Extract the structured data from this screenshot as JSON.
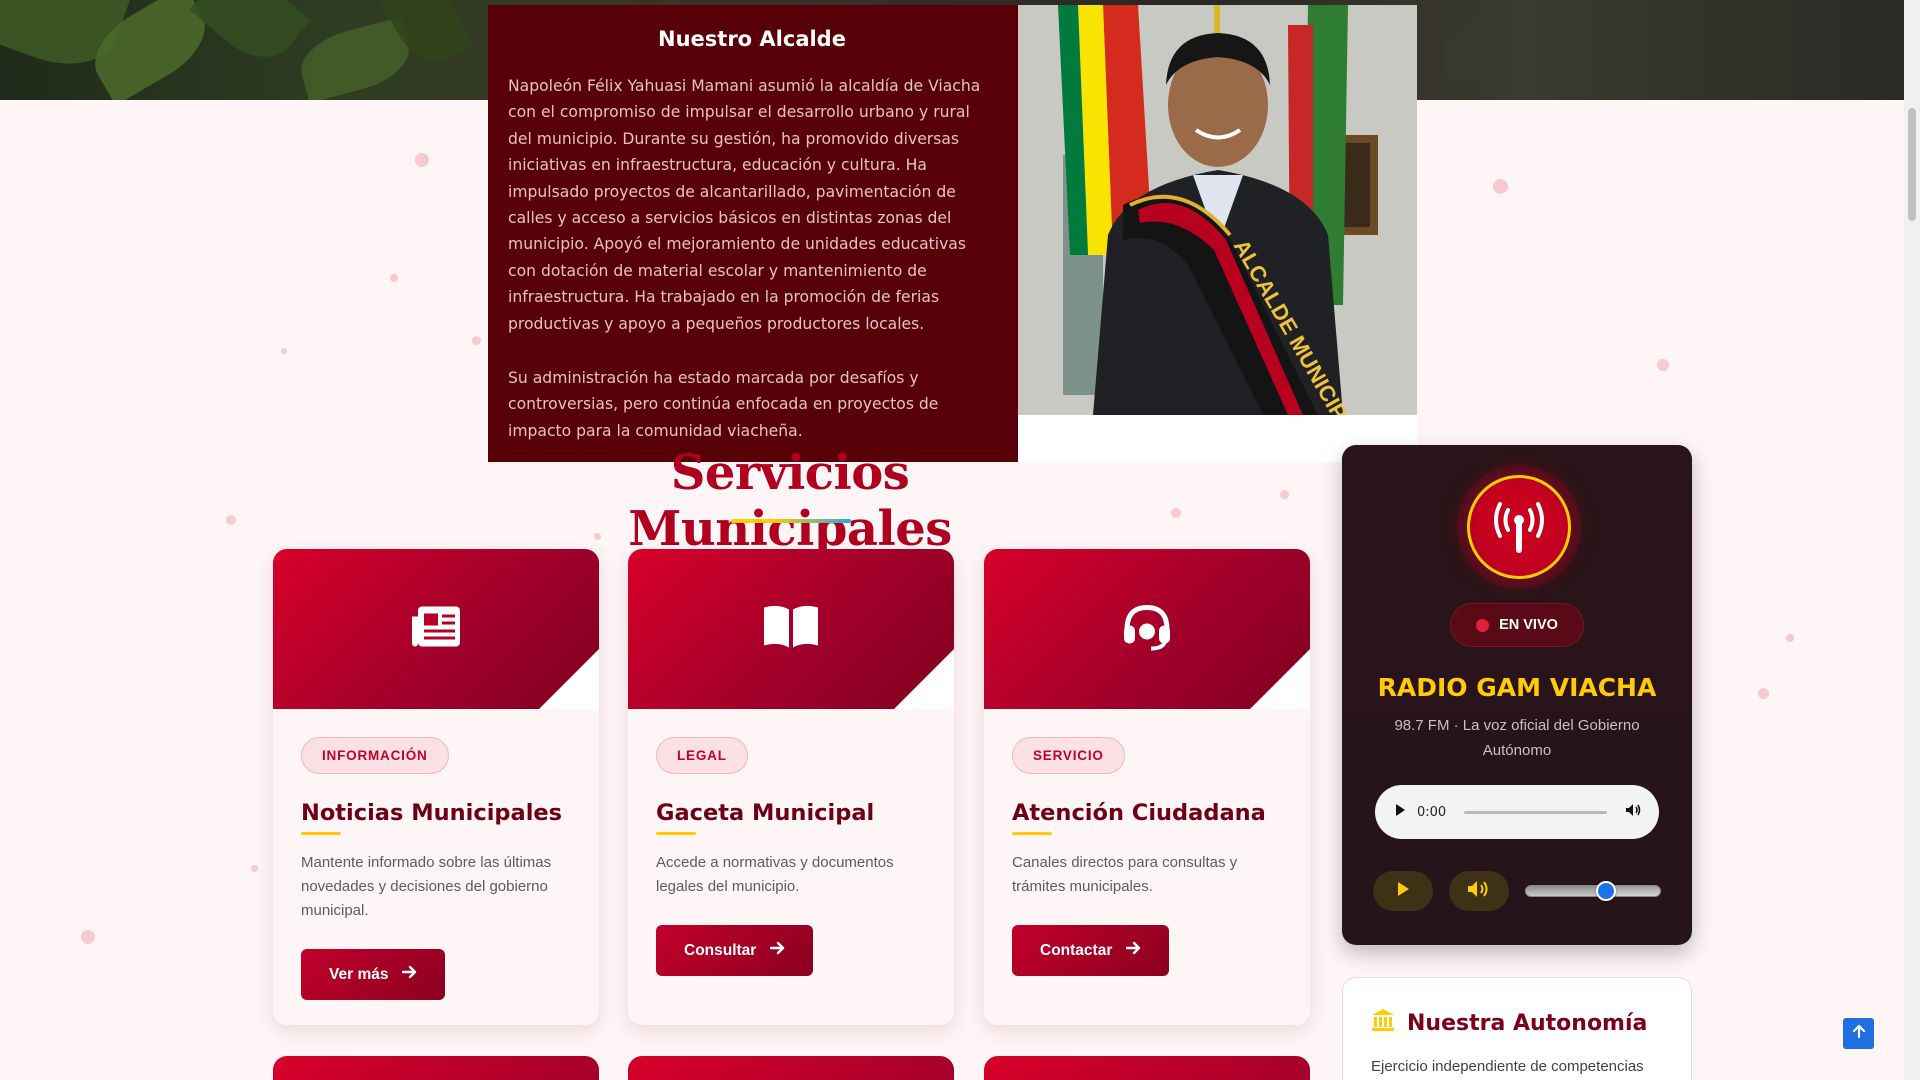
{
  "mayor": {
    "title": "Nuestro Alcalde",
    "paragraph_1": "Napoleón Félix Yahuasi Mamani asumió la alcaldía de Viacha con el compromiso de impulsar el desarrollo urbano y rural del municipio. Durante su gestión, ha promovido diversas iniciativas en infraestructura, educación y cultura. Ha impulsado proyectos de alcantarillado, pavimentación de calles y acceso a servicios básicos en distintas zonas del municipio. Apoyó el mejoramiento de unidades educativas con dotación de material escolar y mantenimiento de infraestructura. Ha trabajado en la promoción de ferias productivas y apoyo a pequeños productores locales.",
    "paragraph_2": "Su administración ha estado marcada por desafíos y controversias, pero continúa enfocada en proyectos de impacto para la comunidad viacheña.",
    "sash_text": "ALCALDE MUNICIPAL G.A.M.V."
  },
  "services": {
    "title": "Servicios Municipales",
    "cards": [
      {
        "icon": "newspaper-icon",
        "badge": "INFORMACIÓN",
        "name": "Noticias Municipales",
        "description": "Mantente informado sobre las últimas novedades y decisiones del gobierno municipal.",
        "button": "Ver más"
      },
      {
        "icon": "book-open-icon",
        "badge": "LEGAL",
        "name": "Gaceta Municipal",
        "description": "Accede a normativas y documentos legales del municipio.",
        "button": "Consultar"
      },
      {
        "icon": "headset-icon",
        "badge": "SERVICIO",
        "name": "Atención Ciudadana",
        "description": "Canales directos para consultas y trámites municipales.",
        "button": "Contactar"
      }
    ]
  },
  "radio": {
    "icon": "broadcast-tower-icon",
    "live_label": "EN VIVO",
    "name": "RADIO GAM VIACHA",
    "subtitle": "98.7 FM · La voz oficial del Gobierno Autónomo",
    "player_time": "0:00",
    "volume_level": 0.6
  },
  "autonomy": {
    "icon": "landmark-icon",
    "title": "Nuestra Autonomía",
    "text": "Ejercicio independiente de competencias"
  },
  "colors": {
    "brand_red": "#c3002a",
    "dark_maroon": "#570007",
    "gold": "#ffcb05",
    "blue": "#2ba7de"
  }
}
